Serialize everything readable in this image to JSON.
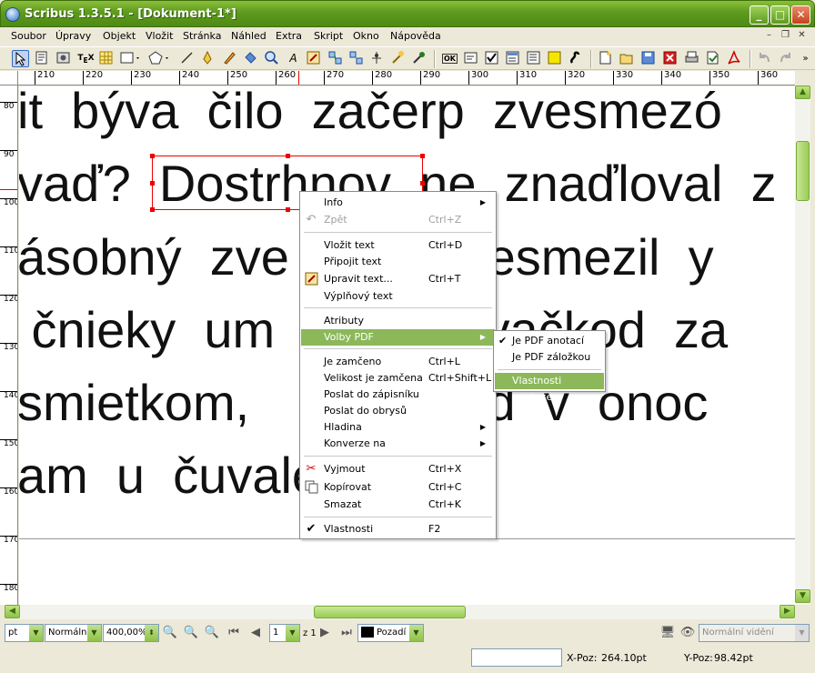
{
  "window": {
    "title": "Scribus 1.3.5.1 - [Dokument-1*]",
    "min": "_",
    "max": "□",
    "close": "✕"
  },
  "menu": {
    "items": [
      "Soubor",
      "Úpravy",
      "Objekt",
      "Vložit",
      "Stránka",
      "Náhled",
      "Extra",
      "Skript",
      "Okno",
      "Nápověda"
    ],
    "mdi": [
      "–",
      "❐",
      "✕"
    ]
  },
  "ruler_top": [
    "210",
    "220",
    "230",
    "240",
    "250",
    "260",
    "270",
    "280",
    "290",
    "300",
    "310",
    "320",
    "330",
    "340",
    "350",
    "360"
  ],
  "ruler_left": [
    "80",
    "90",
    "100",
    "110",
    "120",
    "130",
    "140",
    "150",
    "160",
    "170",
    "180"
  ],
  "canvas_lines": [
    "it  býva  čilo  začerp  zvesmezó",
    "vaď?  Dostrhnov  ne  znaďloval  z",
    "ásobný  zve          Žvesmezil  y",
    " čnieky  um           nyvačkod  za",
    "smietkom,             věd  v  onoc",
    "am  u  čuvale"
  ],
  "context_menu": {
    "items": [
      {
        "label": "Info",
        "shortcut": "",
        "submenu": true,
        "disabled": false,
        "icon": ""
      },
      {
        "label": "Zpět",
        "shortcut": "Ctrl+Z",
        "submenu": false,
        "disabled": true,
        "icon": "undo-icon"
      },
      {
        "label": "Vložit text",
        "shortcut": "Ctrl+D",
        "submenu": false,
        "disabled": false,
        "icon": ""
      },
      {
        "label": "Připojit text",
        "shortcut": "",
        "submenu": false,
        "disabled": false,
        "icon": ""
      },
      {
        "label": "Upravit text...",
        "shortcut": "Ctrl+T",
        "submenu": false,
        "disabled": false,
        "icon": "edit-text-icon"
      },
      {
        "label": "Výplňový text",
        "shortcut": "",
        "submenu": false,
        "disabled": false,
        "icon": ""
      },
      {
        "label": "Atributy",
        "shortcut": "",
        "submenu": false,
        "disabled": false,
        "icon": ""
      },
      {
        "label": "Volby PDF",
        "shortcut": "",
        "submenu": true,
        "disabled": false,
        "icon": "",
        "highlighted": true
      },
      {
        "label": "Je zamčeno",
        "shortcut": "Ctrl+L",
        "submenu": false,
        "disabled": false,
        "icon": ""
      },
      {
        "label": "Velikost je zamčena",
        "shortcut": "Ctrl+Shift+L",
        "submenu": false,
        "disabled": false,
        "icon": ""
      },
      {
        "label": "Poslat do zápisníku",
        "shortcut": "",
        "submenu": false,
        "disabled": false,
        "icon": ""
      },
      {
        "label": "Poslat do obrysů",
        "shortcut": "",
        "submenu": false,
        "disabled": false,
        "icon": ""
      },
      {
        "label": "Hladina",
        "shortcut": "",
        "submenu": true,
        "disabled": false,
        "icon": ""
      },
      {
        "label": "Konverze na",
        "shortcut": "",
        "submenu": true,
        "disabled": false,
        "icon": ""
      },
      {
        "label": "Vyjmout",
        "shortcut": "Ctrl+X",
        "submenu": false,
        "disabled": false,
        "icon": "scissors-icon"
      },
      {
        "label": "Kopírovat",
        "shortcut": "Ctrl+C",
        "submenu": false,
        "disabled": false,
        "icon": "copy-icon"
      },
      {
        "label": "Smazat",
        "shortcut": "Ctrl+K",
        "submenu": false,
        "disabled": false,
        "icon": ""
      },
      {
        "label": "Vlastnosti",
        "shortcut": "F2",
        "submenu": false,
        "disabled": false,
        "icon": "checkmark-icon"
      }
    ]
  },
  "pdf_submenu": {
    "items": [
      {
        "label": "Je PDF anotací",
        "checked": true
      },
      {
        "label": "Je PDF záložkou",
        "checked": false
      },
      {
        "label": "Vlastnosti anotace",
        "checked": false,
        "highlighted": true
      }
    ]
  },
  "bottom": {
    "unit": "pt",
    "mode": "Normální",
    "zoom": "400,00%",
    "page": "1",
    "page_of": "z 1",
    "layer": "Pozadí",
    "view": "Normální vidění"
  },
  "status": {
    "xpos_label": "X-Poz:",
    "xpos_value": "264.10pt",
    "ypos_label": "Y-Poz:",
    "ypos_value": "98.42pt"
  },
  "colors": {
    "accent": "#8cb85a",
    "selection": "#e00000",
    "title_bar": "#5d9a1e"
  }
}
